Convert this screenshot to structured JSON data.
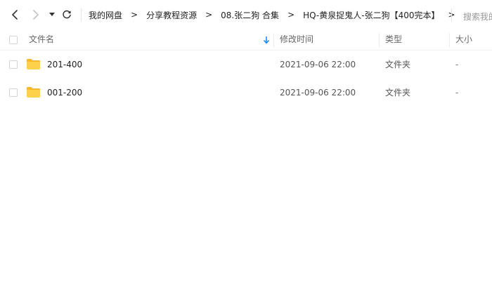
{
  "toolbar": {
    "breadcrumb": [
      "我的网盘",
      "分享教程资源",
      "08.张二狗 合集",
      "HQ-黄泉捉鬼人-张二狗【400完本】"
    ],
    "separator": ">",
    "search_placeholder": "搜索我的网盘文件"
  },
  "columns": {
    "name": "文件名",
    "modified": "修改时间",
    "type": "类型",
    "size": "大小"
  },
  "files": [
    {
      "name": "201-400",
      "modified": "2021-09-06 22:00",
      "type": "文件夹",
      "size": "-"
    },
    {
      "name": "001-200",
      "modified": "2021-09-06 22:00",
      "type": "文件夹",
      "size": "-"
    }
  ],
  "colors": {
    "folder": "#ffd04b",
    "folder_back": "#f7b72e",
    "sort_arrow": "#1e8cf0"
  }
}
